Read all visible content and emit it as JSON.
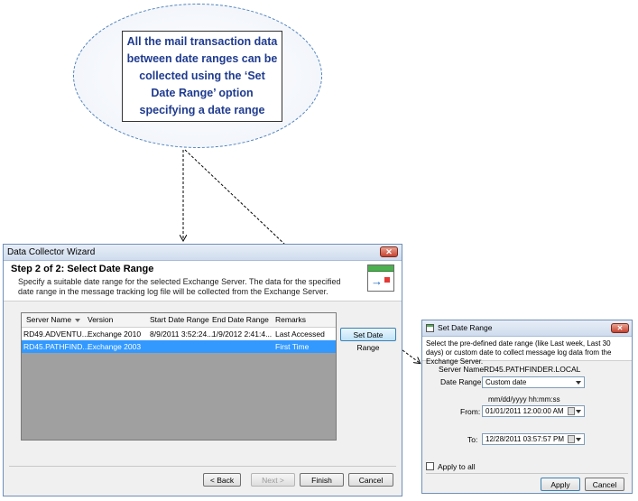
{
  "callout": {
    "text": "All the mail transaction data between date ranges can be collected using the ‘Set Date Range’ option specifying a date range"
  },
  "wizard": {
    "title": "Data Collector Wizard",
    "close_label": "✕",
    "step_title": "Step 2 of 2:  Select Date Range",
    "description": "Specify a suitable date range for the selected Exchange Server. The data for the specified date range in the message tracking log file will be collected from the Exchange Server.",
    "icon": "calendar-arrow-icon",
    "columns": [
      "Server Name",
      "Version",
      "Start Date Range",
      "End Date Range",
      "Remarks"
    ],
    "rows": [
      [
        "RD49.ADVENTU...",
        "Exchange 2010",
        "8/9/2011 3:52:24...",
        "1/9/2012 2:41:4...",
        "Last Accessed"
      ],
      [
        "RD45.PATHFIND...",
        "Exchange 2003",
        "",
        "",
        "First Time"
      ]
    ],
    "set_date_range_label": "Set Date Range",
    "back_label": "< Back",
    "next_label": "Next >",
    "finish_label": "Finish",
    "cancel_label": "Cancel",
    "selection_color": "#3399ff"
  },
  "dialog": {
    "title": "Set Date Range",
    "close_label": "✕",
    "description": "Select the pre-defined date range (like Last week, Last 30 days) or custom date to collect message log data from the Exchange Server.",
    "server_label": "Server Name:",
    "server_value": "RD45.PATHFINDER.LOCAL",
    "date_range_label": "Date Range:",
    "date_range_value": "Custom date",
    "format_hint": "mm/dd/yyyy hh:mm:ss",
    "from_label": "From:",
    "from_value": "01/01/2011  12:00:00 AM",
    "to_label": "To:",
    "to_value": "12/28/2011  03:57:57 PM",
    "apply_all_label": "Apply to all",
    "apply_label": "Apply",
    "cancel_label": "Cancel"
  }
}
